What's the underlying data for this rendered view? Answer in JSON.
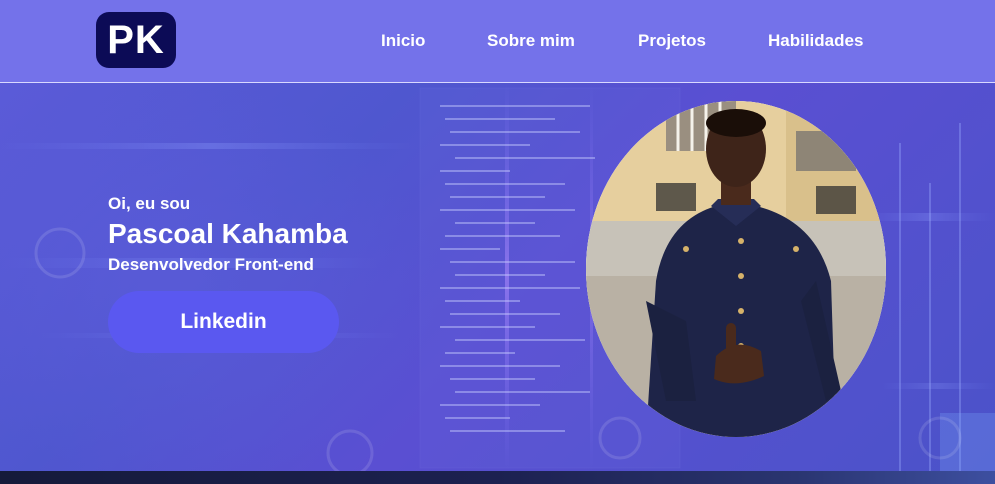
{
  "header": {
    "logo": "PK",
    "nav": [
      {
        "label": "Inicio"
      },
      {
        "label": "Sobre mim"
      },
      {
        "label": "Projetos"
      },
      {
        "label": "Habilidades"
      }
    ]
  },
  "hero": {
    "intro": "Oi, eu sou",
    "name": "Pascoal Kahamba",
    "role": "Desenvolvedor Front-end",
    "cta_label": "Linkedin"
  },
  "colors": {
    "header_bg": "#7472ea",
    "logo_bg": "#0c0b56",
    "button_bg": "#5a58f0",
    "hero_bg": "#5156d0"
  }
}
